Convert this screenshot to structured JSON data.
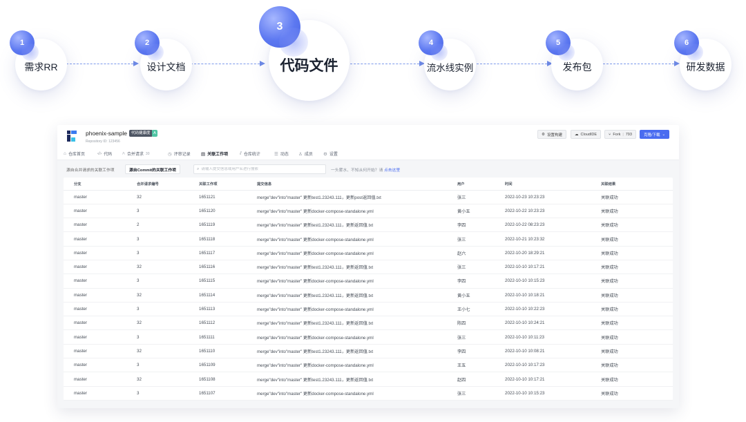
{
  "steps": [
    {
      "num": "1",
      "label": "需求RR"
    },
    {
      "num": "2",
      "label": "设计文档"
    },
    {
      "num": "3",
      "label": "代码文件"
    },
    {
      "num": "4",
      "label": "流水线实例"
    },
    {
      "num": "5",
      "label": "发布包"
    },
    {
      "num": "6",
      "label": "研发数据"
    }
  ],
  "repo": {
    "name": "phoenix-sample",
    "badge": "代码健康度",
    "badge_grade": "A",
    "id_text": "Repository ID: 123456"
  },
  "header_buttons": {
    "build": "设置构建",
    "ide": "CloudIDE",
    "fork": "Fork",
    "fork_count": "793",
    "clone": "克隆/下载"
  },
  "tabs": [
    {
      "label": "仓库首页",
      "icon": "home-icon"
    },
    {
      "label": "代码",
      "icon": "code-icon"
    },
    {
      "label": "合并请求",
      "icon": "merge-request-icon",
      "count": "30"
    },
    {
      "label": "评审记录",
      "icon": "review-icon"
    },
    {
      "label": "关联工作项",
      "icon": "document-icon",
      "active": true
    },
    {
      "label": "仓库统计",
      "icon": "chart-icon"
    },
    {
      "label": "动态",
      "icon": "list-icon"
    },
    {
      "label": "成员",
      "icon": "user-icon"
    },
    {
      "label": "设置",
      "icon": "gear-icon"
    }
  ],
  "filter": {
    "from_mr": "源自合并请求的关联工作项",
    "from_commit": "源自Commit的关联工作项",
    "search_placeholder": "请输入提交信息或用户名进行搜索",
    "hint_text": "一头雾水、不知从何开始？请",
    "hint_link": "点击这里"
  },
  "table": {
    "columns": [
      "分支",
      "合并请求编号",
      "关联工作项",
      "提交信息",
      "用户",
      "时间",
      "关联结果"
    ],
    "rows": [
      [
        "master",
        "32",
        "1651121",
        "merge\"dev\"into\"master\" 更新test1.23243.111，更新post返回值.txt",
        "张三",
        "2022-10-23 10:23:23",
        "关联成功"
      ],
      [
        "master",
        "3",
        "1651120",
        "merge\"dev\"into\"master\" 更新docker-compose-standalone.yml",
        "黄小五",
        "2022-10-22 10:23:23",
        "关联成功"
      ],
      [
        "master",
        "2",
        "1651119",
        "merge\"dev\"into\"master\" 更新test1.23243.111，更新返回值.txt",
        "李四",
        "2022-10-22 08:23:23",
        "关联成功"
      ],
      [
        "master",
        "3",
        "1651118",
        "merge\"dev\"into\"master\" 更新docker-compose-standalone.yml",
        "张三",
        "2022-10-21 10:23:32",
        "关联成功"
      ],
      [
        "master",
        "3",
        "1651117",
        "merge\"dev\"into\"master\" 更新docker-compose-standalone.yml",
        "赵六",
        "2022-10-20 18:29:21",
        "关联成功"
      ],
      [
        "master",
        "32",
        "1651116",
        "merge\"dev\"into\"master\" 更新test1.23243.111，更新返回值.txt",
        "张三",
        "2022-10-10 10:17:21",
        "关联成功"
      ],
      [
        "master",
        "3",
        "1651115",
        "merge\"dev\"into\"master\" 更新docker-compose-standalone.yml",
        "李四",
        "2022-10-10 10:15:23",
        "关联成功"
      ],
      [
        "master",
        "32",
        "1651114",
        "merge\"dev\"into\"master\" 更新test1.23243.111，更新返回值.txt",
        "黄小五",
        "2022-10-10 10:18:21",
        "关联成功"
      ],
      [
        "master",
        "3",
        "1651113",
        "merge\"dev\"into\"master\" 更新docker-compose-standalone.yml",
        "王小七",
        "2022-10-10 10:22:23",
        "关联成功"
      ],
      [
        "master",
        "32",
        "1651112",
        "merge\"dev\"into\"master\" 更新test1.23243.111，更新返回值.txt",
        "陈四",
        "2022-10-10 10:24:21",
        "关联成功"
      ],
      [
        "master",
        "3",
        "1651111",
        "merge\"dev\"into\"master\" 更新docker-compose-standalone.yml",
        "张三",
        "2022-10-10 10:11:23",
        "关联成功"
      ],
      [
        "master",
        "32",
        "1651110",
        "merge\"dev\"into\"master\" 更新test1.23243.111，更新返回值.txt",
        "李四",
        "2022-10-10 10:08:21",
        "关联成功"
      ],
      [
        "master",
        "3",
        "1651109",
        "merge\"dev\"into\"master\" 更新docker-compose-standalone.yml",
        "王五",
        "2022-10-10 10:17:23",
        "关联成功"
      ],
      [
        "master",
        "32",
        "1651108",
        "merge\"dev\"into\"master\" 更新test1.23243.111，更新返回值.txt",
        "赵四",
        "2022-10-10 10:17:21",
        "关联成功"
      ],
      [
        "master",
        "3",
        "1651107",
        "merge\"dev\"into\"master\" 更新docker-compose-standalone.yml",
        "张三",
        "2022-10-10 10:15:23",
        "关联成功"
      ]
    ]
  },
  "colors": {
    "accent": "#4a6cf0",
    "badge_dark": "#4d5563",
    "grade_green": "#4fc5a4"
  }
}
